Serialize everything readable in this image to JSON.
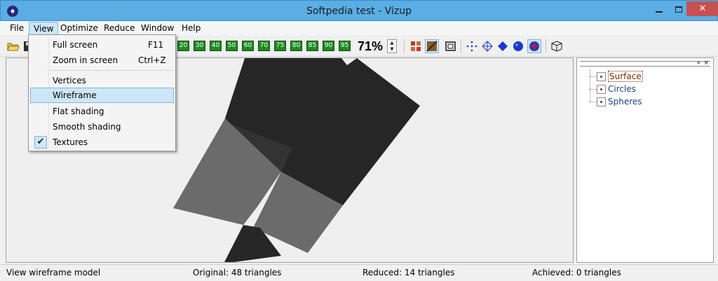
{
  "window": {
    "title": "Softpedia test - Vizup",
    "close_glyph": "✕"
  },
  "menubar": {
    "items": [
      "File",
      "View",
      "Optimize",
      "Reduce",
      "Window",
      "Help"
    ]
  },
  "view_menu": {
    "items": [
      {
        "label": "Full screen",
        "shortcut": "F11"
      },
      {
        "label": "Zoom in screen",
        "shortcut": "Ctrl+Z"
      },
      {
        "label": "Vertices"
      },
      {
        "label": "Wireframe"
      },
      {
        "label": "Flat shading"
      },
      {
        "label": "Smooth shading"
      },
      {
        "label": "Textures"
      }
    ],
    "check_glyph": "✔"
  },
  "toolbar": {
    "percent_buttons": [
      "20",
      "30",
      "40",
      "50",
      "60",
      "70",
      "75",
      "80",
      "85",
      "90",
      "95"
    ],
    "zoom": "71%",
    "spin_up": "▲",
    "spin_down": "▼"
  },
  "tree": {
    "nodes": [
      "Surface",
      "Circles",
      "Spheres"
    ],
    "ctrl_left": "«",
    "ctrl_right": "×"
  },
  "statusbar": {
    "hint": "View wireframe model",
    "original": "Original: 48 triangles",
    "reduced": "Reduced: 14 triangles",
    "achieved": "Achieved: 0 triangles"
  },
  "colors": {
    "titlebar": "#5aaee4",
    "close_button": "#c75050",
    "highlight": "#cde6f7",
    "percent_button": "#1e8b1e",
    "model_dark": "#262626",
    "model_mid": "#6b6b6b"
  }
}
